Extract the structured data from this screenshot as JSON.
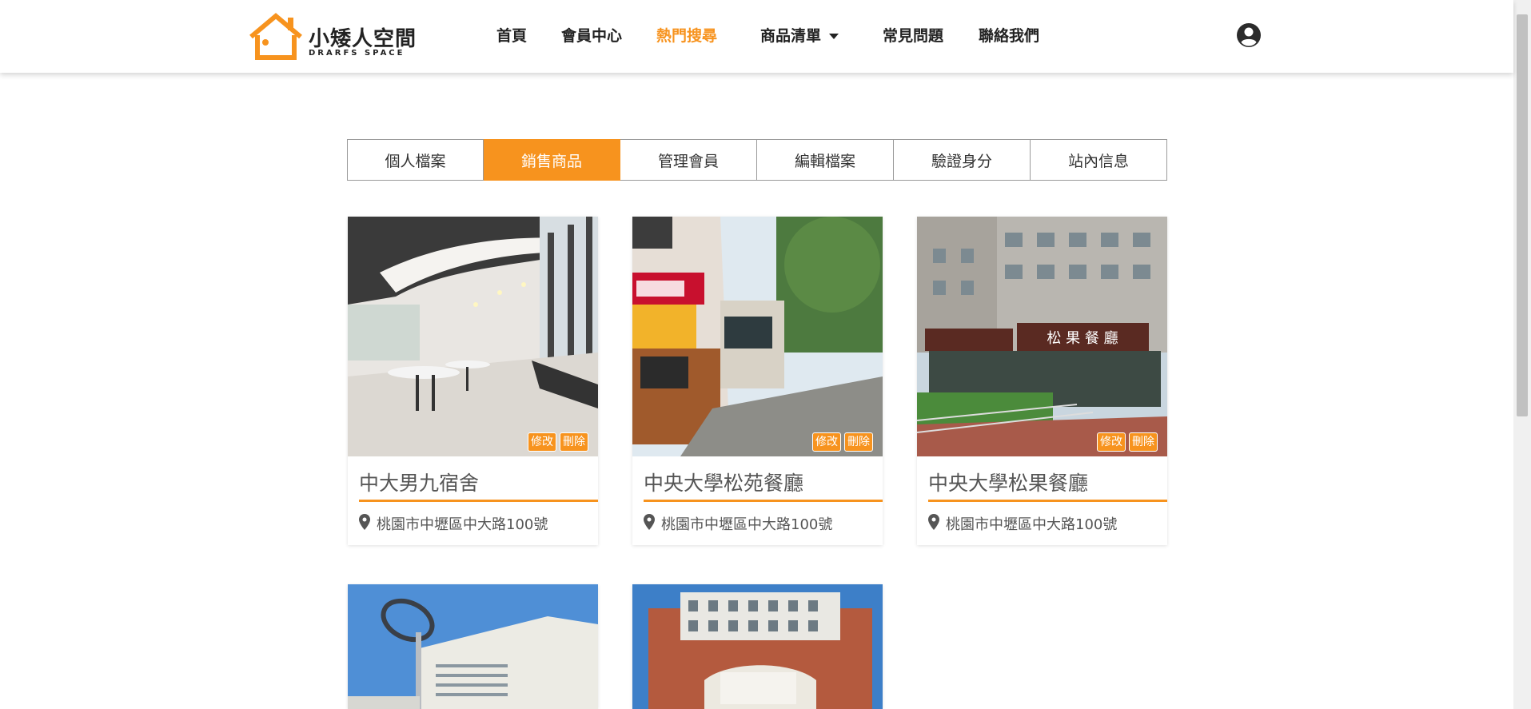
{
  "brand": {
    "name": "小矮人空間",
    "subtitle": "DRARFS SPACE",
    "orange": "#f7931e"
  },
  "nav": {
    "home": "首頁",
    "member_center": "會員中心",
    "popular_search": "熱門搜尋",
    "product_list": "商品清單",
    "faq": "常見問題",
    "contact": "聯絡我們"
  },
  "tabs": [
    {
      "label": "個人檔案"
    },
    {
      "label": "銷售商品"
    },
    {
      "label": "管理會員"
    },
    {
      "label": "編輯檔案"
    },
    {
      "label": "驗證身分"
    },
    {
      "label": "站內信息"
    }
  ],
  "actions": {
    "edit": "修改",
    "delete": "刪除"
  },
  "listings": [
    {
      "title": "中大男九宿舍",
      "address": "桃園市中壢區中大路100號"
    },
    {
      "title": "中央大學松苑餐廳",
      "address": "桃園市中壢區中大路100號"
    },
    {
      "title": "中央大學松果餐廳",
      "address": "桃園市中壢區中大路100號"
    },
    {
      "title": "",
      "address": ""
    },
    {
      "title": "",
      "address": ""
    }
  ],
  "photo_text": {
    "sign": "松 果 餐 廳"
  }
}
